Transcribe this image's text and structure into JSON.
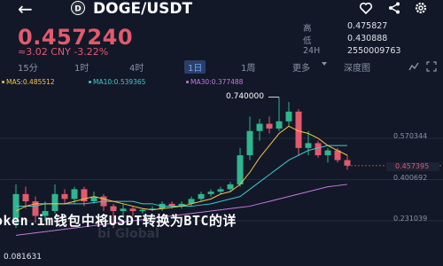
{
  "header": {
    "back_icon": "back-arrow-icon",
    "pair_icon": "doge-coin-icon",
    "pair": "DOGE/USDT",
    "icons": [
      "favorite-icon",
      "share-icon",
      "settings-icon"
    ]
  },
  "ticker": {
    "price": "0.457240",
    "change": "≈3.02 CNY  -3.22%"
  },
  "stats": [
    {
      "label": "高",
      "value": "0.475827"
    },
    {
      "label": "低",
      "value": "0.430888"
    },
    {
      "label": "24H",
      "value": "2550009763"
    }
  ],
  "tabs": [
    {
      "label": "15分"
    },
    {
      "label": "1时"
    },
    {
      "label": "4时"
    },
    {
      "label": "1日",
      "active": true
    },
    {
      "label": "1周"
    },
    {
      "label": "更多"
    },
    {
      "label": "深度图"
    }
  ],
  "tab_icons": [
    "indicator-icon",
    "fullscreen-icon"
  ],
  "ma": [
    {
      "text": "MAS:0.485512",
      "color": "#f5c34a"
    },
    {
      "text": "MA10:0.539365",
      "color": "#3fc9c9"
    },
    {
      "text": "MA30:0.377488",
      "color": "#c678dd"
    }
  ],
  "chart_data": {
    "type": "candlestick",
    "high_label": "0.740000",
    "current_price": "0.457395",
    "y_ticks": [
      "0.570344",
      "0.400692",
      "0.231039"
    ],
    "low_label": "0.081631",
    "up_color": "#2fb68e",
    "down_color": "#e35a6b",
    "candles": [
      {
        "o": 0.24,
        "c": 0.34,
        "h": 0.38,
        "l": 0.2
      },
      {
        "o": 0.34,
        "c": 0.31,
        "h": 0.37,
        "l": 0.28
      },
      {
        "o": 0.31,
        "c": 0.25,
        "h": 0.33,
        "l": 0.22
      },
      {
        "o": 0.25,
        "c": 0.27,
        "h": 0.31,
        "l": 0.23
      },
      {
        "o": 0.27,
        "c": 0.34,
        "h": 0.38,
        "l": 0.26
      },
      {
        "o": 0.34,
        "c": 0.32,
        "h": 0.36,
        "l": 0.3
      },
      {
        "o": 0.32,
        "c": 0.36,
        "h": 0.37,
        "l": 0.3
      },
      {
        "o": 0.36,
        "c": 0.31,
        "h": 0.37,
        "l": 0.29
      },
      {
        "o": 0.31,
        "c": 0.33,
        "h": 0.35,
        "l": 0.3
      },
      {
        "o": 0.33,
        "c": 0.29,
        "h": 0.34,
        "l": 0.27
      },
      {
        "o": 0.29,
        "c": 0.27,
        "h": 0.3,
        "l": 0.2
      },
      {
        "o": 0.27,
        "c": 0.28,
        "h": 0.3,
        "l": 0.25
      },
      {
        "o": 0.28,
        "c": 0.27,
        "h": 0.29,
        "l": 0.25
      },
      {
        "o": 0.27,
        "c": 0.275,
        "h": 0.28,
        "l": 0.26
      },
      {
        "o": 0.275,
        "c": 0.28,
        "h": 0.29,
        "l": 0.27
      },
      {
        "o": 0.28,
        "c": 0.3,
        "h": 0.31,
        "l": 0.27
      },
      {
        "o": 0.3,
        "c": 0.29,
        "h": 0.31,
        "l": 0.28
      },
      {
        "o": 0.29,
        "c": 0.3,
        "h": 0.31,
        "l": 0.28
      },
      {
        "o": 0.3,
        "c": 0.32,
        "h": 0.33,
        "l": 0.29
      },
      {
        "o": 0.32,
        "c": 0.34,
        "h": 0.35,
        "l": 0.31
      },
      {
        "o": 0.34,
        "c": 0.35,
        "h": 0.36,
        "l": 0.33
      },
      {
        "o": 0.35,
        "c": 0.36,
        "h": 0.37,
        "l": 0.34
      },
      {
        "o": 0.36,
        "c": 0.38,
        "h": 0.39,
        "l": 0.35
      },
      {
        "o": 0.38,
        "c": 0.5,
        "h": 0.53,
        "l": 0.37
      },
      {
        "o": 0.5,
        "c": 0.6,
        "h": 0.66,
        "l": 0.48
      },
      {
        "o": 0.6,
        "c": 0.63,
        "h": 0.65,
        "l": 0.56
      },
      {
        "o": 0.63,
        "c": 0.61,
        "h": 0.66,
        "l": 0.59
      },
      {
        "o": 0.61,
        "c": 0.64,
        "h": 0.74,
        "l": 0.6
      },
      {
        "o": 0.64,
        "c": 0.68,
        "h": 0.72,
        "l": 0.62
      },
      {
        "o": 0.68,
        "c": 0.53,
        "h": 0.69,
        "l": 0.5
      },
      {
        "o": 0.53,
        "c": 0.55,
        "h": 0.6,
        "l": 0.5
      },
      {
        "o": 0.55,
        "c": 0.5,
        "h": 0.56,
        "l": 0.49
      },
      {
        "o": 0.5,
        "c": 0.52,
        "h": 0.53,
        "l": 0.47
      },
      {
        "o": 0.52,
        "c": 0.48,
        "h": 0.53,
        "l": 0.47
      },
      {
        "o": 0.48,
        "c": 0.457,
        "h": 0.5,
        "l": 0.44
      }
    ],
    "ma5": [
      0.27,
      0.29,
      0.3,
      0.3,
      0.3,
      0.3,
      0.31,
      0.32,
      0.33,
      0.32,
      0.31,
      0.3,
      0.29,
      0.28,
      0.275,
      0.28,
      0.285,
      0.29,
      0.3,
      0.31,
      0.32,
      0.34,
      0.35,
      0.38,
      0.43,
      0.49,
      0.54,
      0.59,
      0.62,
      0.6,
      0.59,
      0.57,
      0.54,
      0.52,
      0.5
    ],
    "ma10": [
      0.29,
      0.29,
      0.29,
      0.3,
      0.3,
      0.3,
      0.3,
      0.3,
      0.305,
      0.31,
      0.31,
      0.31,
      0.31,
      0.3,
      0.3,
      0.29,
      0.29,
      0.29,
      0.29,
      0.295,
      0.3,
      0.31,
      0.32,
      0.33,
      0.36,
      0.39,
      0.42,
      0.45,
      0.48,
      0.5,
      0.52,
      0.53,
      0.54,
      0.54,
      0.54
    ],
    "ma30": [
      0.17,
      0.175,
      0.18,
      0.185,
      0.19,
      0.195,
      0.2,
      0.205,
      0.21,
      0.215,
      0.22,
      0.225,
      0.23,
      0.235,
      0.24,
      0.245,
      0.25,
      0.255,
      0.26,
      0.265,
      0.27,
      0.275,
      0.28,
      0.285,
      0.29,
      0.3,
      0.31,
      0.32,
      0.33,
      0.34,
      0.35,
      0.36,
      0.37,
      0.375,
      0.38
    ]
  },
  "overlay_text": "oken.im钱包中将USDT转换为BTC的详",
  "watermark": "bi Global"
}
